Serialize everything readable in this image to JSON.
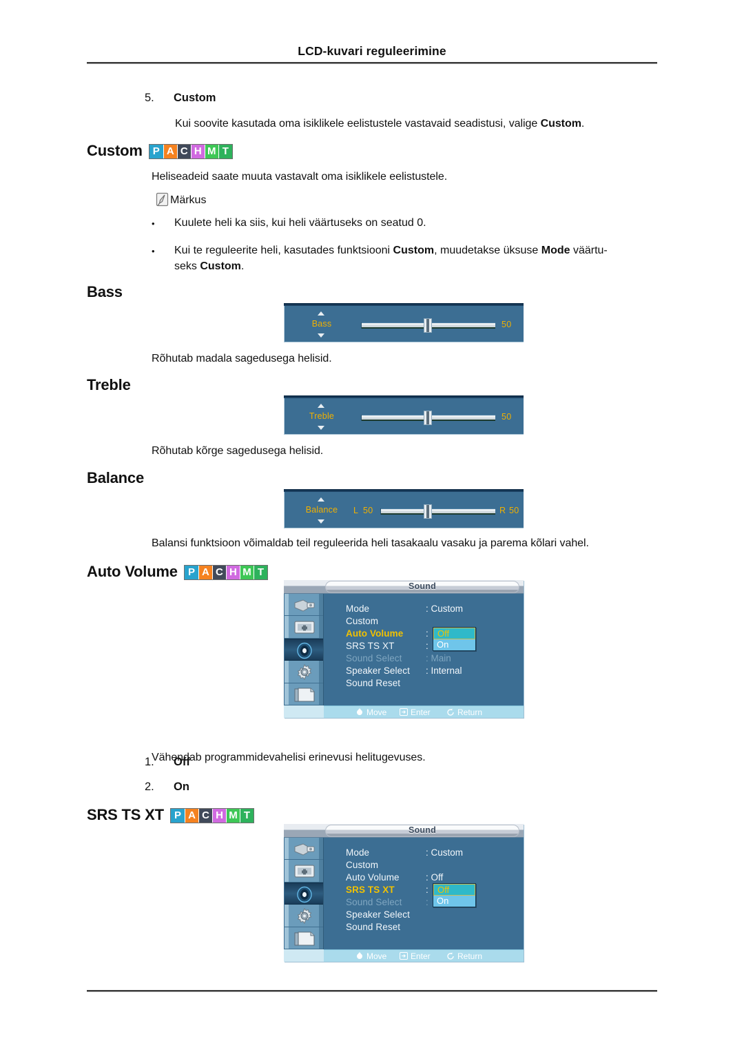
{
  "header": {
    "title": "LCD-kuvari reguleerimine"
  },
  "badge": {
    "letters": [
      "P",
      "A",
      "C",
      "H",
      "M",
      "T"
    ],
    "colors": [
      "#29a3cd",
      "#f58220",
      "#414a5a",
      "#d06ae0",
      "#3ec756",
      "#2eb25c"
    ]
  },
  "intro": {
    "number": "5.",
    "label": "Custom",
    "paragraph_pre": "Kui soovite kasutada oma isiklikele eelistustele vastavaid seadistusi, valige ",
    "paragraph_bold": "Custom",
    "paragraph_post": "."
  },
  "custom": {
    "heading": "Custom",
    "description": "Heliseadeid saate muuta vastavalt oma isiklikele eelistustele.",
    "note_label": "Märkus",
    "bullets": [
      {
        "text": "Kuulete heli ka siis, kui heli väärtuseks on seatud 0."
      }
    ],
    "bullet2_p1": "Kui te reguleerite heli, kasutades funktsiooni ",
    "bullet2_b1": "Custom",
    "bullet2_p2": ", muudetakse üksuse ",
    "bullet2_b2": "Mode",
    "bullet2_p3": " väärtu-",
    "bullet2_p4": "seks ",
    "bullet2_b3": "Custom",
    "bullet2_p5": "."
  },
  "bass": {
    "heading": "Bass",
    "slider_label": "Bass",
    "value": "50",
    "description": "Rõhutab madala sagedusega helisid."
  },
  "treble": {
    "heading": "Treble",
    "slider_label": "Treble",
    "value": "50",
    "description": "Rõhutab kõrge sagedusega helisid."
  },
  "balance": {
    "heading": "Balance",
    "slider_label": "Balance",
    "left_label": "L",
    "left_value": "50",
    "right_label": "R",
    "right_value": "50",
    "description": "Balansi funktsioon võimaldab teil reguleerida heli tasakaalu vasaku ja parema kõlari vahel."
  },
  "auto_volume": {
    "heading": "Auto Volume",
    "description": "Vähendab programmidevahelisi erinevusi helitugevuses.",
    "options": [
      {
        "number": "1.",
        "label": "Off"
      },
      {
        "number": "2.",
        "label": "On"
      }
    ]
  },
  "srs": {
    "heading": "SRS TS XT"
  },
  "osd1": {
    "title": "Sound",
    "rows": [
      {
        "label": "Mode",
        "value": ": Custom"
      },
      {
        "label": "Custom",
        "value": ""
      },
      {
        "label": "Auto Volume",
        "value": ":"
      },
      {
        "label": "SRS TS XT",
        "value": ":"
      },
      {
        "label": "Sound Select",
        "value": ": Main"
      },
      {
        "label": "Speaker Select",
        "value": ": Internal"
      },
      {
        "label": "Sound Reset",
        "value": ""
      }
    ],
    "dropdown": [
      "Off",
      "On"
    ],
    "footer": [
      {
        "icon": "move-icon",
        "label": "Move"
      },
      {
        "icon": "enter-icon",
        "label": "Enter"
      },
      {
        "icon": "return-icon",
        "label": "Return"
      }
    ]
  },
  "osd2": {
    "title": "Sound",
    "rows": [
      {
        "label": "Mode",
        "value": ": Custom"
      },
      {
        "label": "Custom",
        "value": ""
      },
      {
        "label": "Auto Volume",
        "value": ": Off"
      },
      {
        "label": "SRS TS XT",
        "value": ":"
      },
      {
        "label": "Sound Select",
        "value": ":"
      },
      {
        "label": "Speaker Select",
        "value": ""
      },
      {
        "label": "Sound Reset",
        "value": ""
      }
    ],
    "dropdown": [
      "Off",
      "On"
    ],
    "footer": [
      {
        "icon": "move-icon",
        "label": "Move"
      },
      {
        "icon": "enter-icon",
        "label": "Enter"
      },
      {
        "icon": "return-icon",
        "label": "Return"
      }
    ]
  },
  "osd_sidebar_icons": [
    "input-source-icon",
    "picture-icon",
    "sound-icon",
    "setup-icon",
    "multicontrol-icon"
  ]
}
